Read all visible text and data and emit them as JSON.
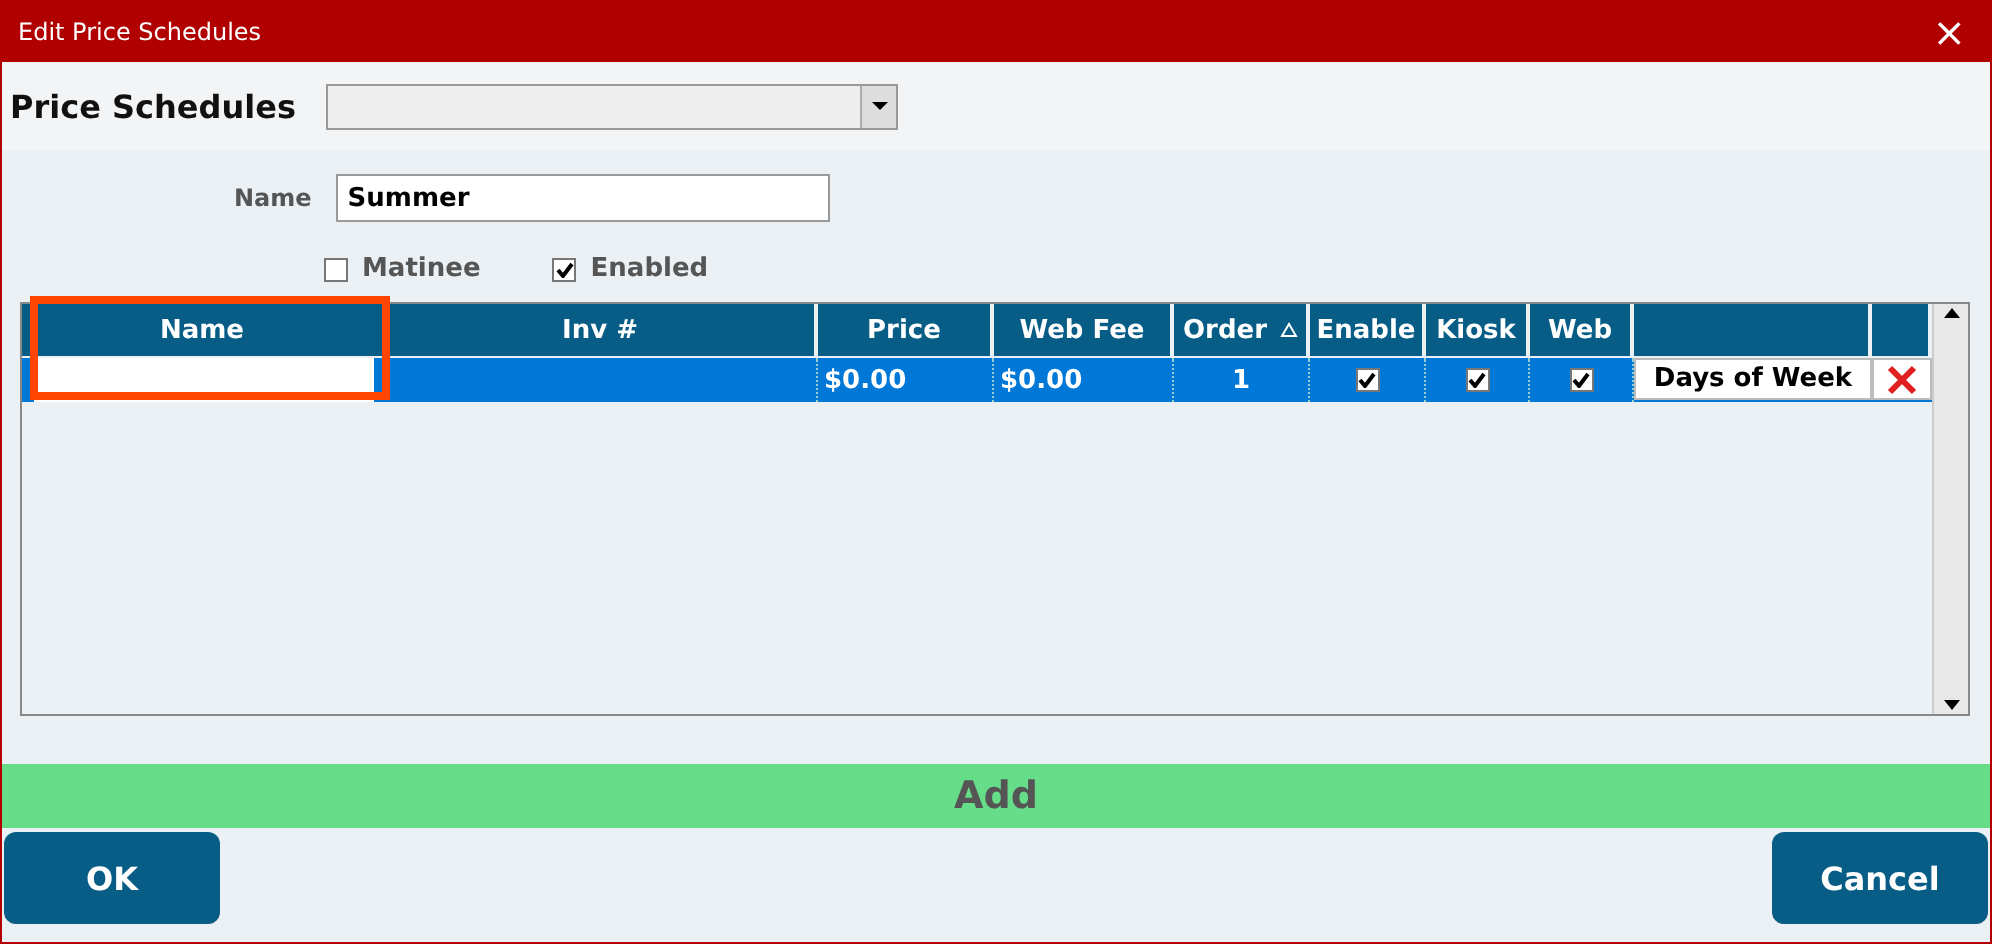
{
  "window": {
    "title": "Edit Price Schedules",
    "close": "×"
  },
  "schedule_picker": {
    "label": "Price Schedules"
  },
  "name_field": {
    "label": "Name",
    "value": "Summer"
  },
  "options": [
    {
      "label": "Matinee",
      "checked": false
    },
    {
      "label": "Enabled",
      "checked": true
    }
  ],
  "table": {
    "columns": [
      {
        "label": "Name",
        "sorted": false
      },
      {
        "label": "Inv #",
        "sorted": false
      },
      {
        "label": "Price",
        "sorted": false
      },
      {
        "label": "Web Fee",
        "sorted": false
      },
      {
        "label": "Order",
        "sorted": true
      },
      {
        "label": "Enable",
        "sorted": false
      },
      {
        "label": "Kiosk",
        "sorted": false
      },
      {
        "label": "Web",
        "sorted": false
      },
      {
        "sorted": false
      },
      {
        "sorted": false
      }
    ],
    "rows": [
      {
        "selected": true,
        "price": "$0.00",
        "web_fee": "$0.00",
        "order": "1",
        "enable": true,
        "kiosk": true,
        "web": true,
        "days_button": "Days of Week"
      }
    ]
  },
  "add_button": "Add",
  "buttons": [
    {
      "label": "OK"
    },
    {
      "label": "Cancel"
    }
  ]
}
